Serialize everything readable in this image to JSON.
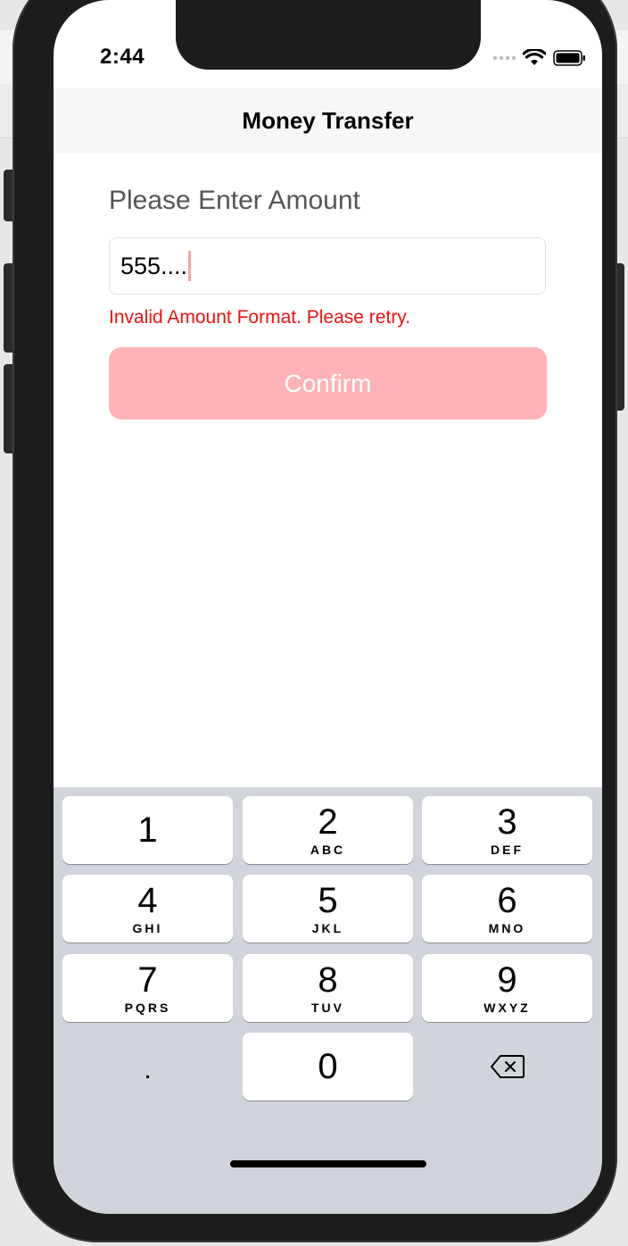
{
  "status_bar": {
    "time": "2:44",
    "signal_icon": "signal-dots-icon",
    "wifi_icon": "wifi-icon",
    "battery_icon": "battery-icon"
  },
  "nav": {
    "title": "Money Transfer"
  },
  "form": {
    "label": "Please Enter Amount",
    "amount_value": "555....",
    "error_message": "Invalid Amount Format. Please retry.",
    "confirm_label": "Confirm"
  },
  "keypad": {
    "keys": [
      {
        "digit": "1",
        "letters": ""
      },
      {
        "digit": "2",
        "letters": "ABC"
      },
      {
        "digit": "3",
        "letters": "DEF"
      },
      {
        "digit": "4",
        "letters": "GHI"
      },
      {
        "digit": "5",
        "letters": "JKL"
      },
      {
        "digit": "6",
        "letters": "MNO"
      },
      {
        "digit": "7",
        "letters": "PQRS"
      },
      {
        "digit": "8",
        "letters": "TUV"
      },
      {
        "digit": "9",
        "letters": "WXYZ"
      }
    ],
    "decimal": ".",
    "zero": "0",
    "delete_icon": "backspace-icon"
  },
  "colors": {
    "error": "#ee1111",
    "confirm_disabled": "#ffb3b6",
    "keyboard_bg": "#d1d4db"
  }
}
